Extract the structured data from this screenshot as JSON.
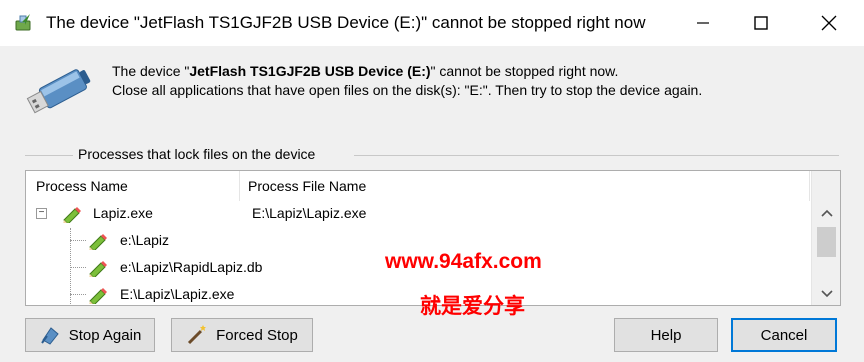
{
  "window": {
    "title": "The device \"JetFlash TS1GJF2B USB Device (E:)\" cannot be stopped right now",
    "minimize_glyph": "—",
    "maximize_glyph": "☐",
    "close_glyph": "✕"
  },
  "message": {
    "line1_prefix": "The device \"",
    "device_name": "JetFlash TS1GJF2B USB Device (E:)",
    "line1_suffix": "\" cannot be stopped right now.",
    "line2": "Close all applications that have open files on the disk(s): \"E:\". Then try to stop the device again."
  },
  "group": {
    "title": "Processes that lock files on the device"
  },
  "list": {
    "columns": [
      "Process Name",
      "Process File Name"
    ],
    "process": {
      "name": "Lapiz.exe",
      "file": "E:\\Lapiz\\Lapiz.exe",
      "toggle": "−"
    },
    "children": [
      {
        "name": "e:\\Lapiz"
      },
      {
        "name": "e:\\Lapiz\\RapidLapiz.db"
      },
      {
        "name": "E:\\Lapiz\\Lapiz.exe"
      }
    ]
  },
  "watermark": {
    "url": "www.94afx.com",
    "text": "就是爱分享"
  },
  "buttons": {
    "stop_again": "Stop Again",
    "forced_stop": "Forced Stop",
    "help": "Help",
    "cancel": "Cancel"
  },
  "colors": {
    "accent": "#0078d7",
    "watermark": "#ff0000",
    "background": "#f0f0f0"
  },
  "icons": {
    "title": "usb-eject-arrow-icon",
    "device": "usb-flash-drive-icon",
    "process": "pencil-icon",
    "stop_again": "eject-icon",
    "forced_stop": "magic-wand-icon"
  }
}
